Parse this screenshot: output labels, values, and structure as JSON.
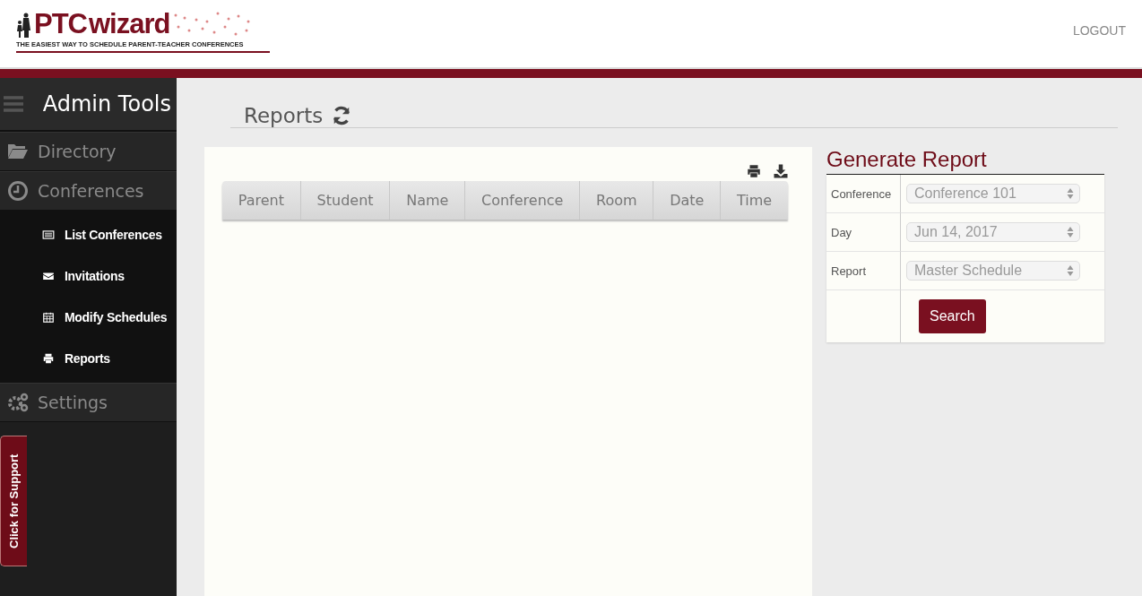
{
  "header": {
    "logo": {
      "brand_part_1": "PTC",
      "brand_part_2": "wizard",
      "tagline": "THE EASIEST WAY TO SCHEDULE PARENT-TEACHER CONFERENCES"
    },
    "logout": "LOGOUT"
  },
  "sidebar": {
    "title": "Admin Tools",
    "sections": [
      {
        "label": "Directory"
      },
      {
        "label": "Conferences",
        "children": [
          {
            "label": "List Conferences"
          },
          {
            "label": "Invitations"
          },
          {
            "label": "Modify Schedules"
          },
          {
            "label": "Reports"
          }
        ]
      },
      {
        "label": "Settings"
      }
    ],
    "support_tab": "Click for Support"
  },
  "page": {
    "title": "Reports"
  },
  "table": {
    "columns": [
      "Parent",
      "Student",
      "Name",
      "Conference",
      "Room",
      "Date",
      "Time"
    ]
  },
  "generate_report": {
    "title": "Generate Report",
    "fields": [
      {
        "label": "Conference",
        "value": "Conference 101"
      },
      {
        "label": "Day",
        "value": "Jun 14, 2017"
      },
      {
        "label": "Report",
        "value": "Master Schedule"
      }
    ],
    "button": "Search"
  }
}
